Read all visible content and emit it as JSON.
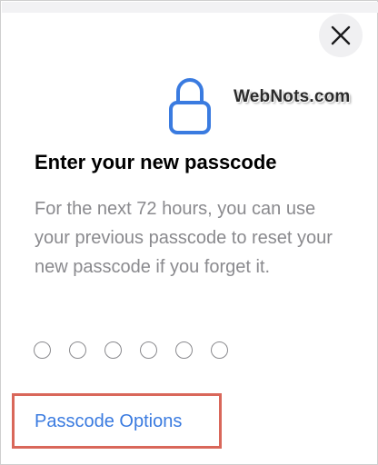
{
  "watermark": "WebNots.com",
  "dialog": {
    "close_icon": "close-icon",
    "lock_icon": "lock-icon",
    "title": "Enter your new passcode",
    "description": "For the next 72 hours, you can use your previous passcode to reset your new passcode if you forget it.",
    "passcode_length": 6,
    "options_label": "Passcode Options"
  },
  "colors": {
    "accent": "#3a7be0",
    "highlight_border": "#d9675a",
    "secondary_text": "#8a8a8e"
  }
}
